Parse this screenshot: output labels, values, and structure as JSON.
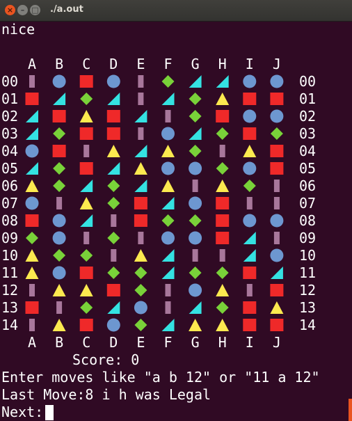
{
  "window": {
    "title": "./a.out",
    "close_icon": "close-icon",
    "minimize_icon": "minimize-icon",
    "maximize_icon": "maximize-icon"
  },
  "terminal": {
    "greeting": "nice",
    "score_line": "Score: 0",
    "instructions": "Enter moves like \"a b 12\" or \"11 a 12\"",
    "last_move": "Last Move:8 i h was Legal",
    "prompt": "Next:"
  },
  "board": {
    "columns": [
      "A",
      "B",
      "C",
      "D",
      "E",
      "F",
      "G",
      "H",
      "I",
      "J"
    ],
    "rows": [
      "00",
      "01",
      "02",
      "03",
      "04",
      "05",
      "06",
      "07",
      "08",
      "09",
      "10",
      "11",
      "12",
      "13",
      "14"
    ],
    "piece_colors": {
      "bar": "#a8779b",
      "circle": "#6d97d0",
      "square": "#ef2929",
      "diamond": "#79d239",
      "triangle": "#fce94f",
      "wedge": "#34e2e2"
    },
    "cells": [
      [
        "bar",
        "circle",
        "square",
        "circle",
        "bar",
        "diamond",
        "wedge",
        "wedge",
        "circle",
        "circle"
      ],
      [
        "square",
        "wedge",
        "diamond",
        "wedge",
        "bar",
        "wedge",
        "diamond",
        "triangle",
        "square",
        "square"
      ],
      [
        "wedge",
        "square",
        "triangle",
        "square",
        "wedge",
        "bar",
        "diamond",
        "square",
        "circle",
        "circle"
      ],
      [
        "wedge",
        "diamond",
        "square",
        "square",
        "bar",
        "circle",
        "wedge",
        "diamond",
        "square",
        "diamond"
      ],
      [
        "circle",
        "square",
        "bar",
        "triangle",
        "wedge",
        "triangle",
        "diamond",
        "bar",
        "triangle",
        "square"
      ],
      [
        "wedge",
        "diamond",
        "square",
        "wedge",
        "triangle",
        "circle",
        "circle",
        "diamond",
        "circle",
        "square"
      ],
      [
        "triangle",
        "diamond",
        "wedge",
        "diamond",
        "wedge",
        "triangle",
        "bar",
        "triangle",
        "diamond",
        "bar"
      ],
      [
        "circle",
        "bar",
        "triangle",
        "diamond",
        "square",
        "wedge",
        "circle",
        "square",
        "bar",
        "bar"
      ],
      [
        "square",
        "circle",
        "wedge",
        "bar",
        "square",
        "diamond",
        "diamond",
        "square",
        "circle",
        "circle"
      ],
      [
        "diamond",
        "circle",
        "bar",
        "diamond",
        "bar",
        "circle",
        "circle",
        "square",
        "wedge",
        "bar"
      ],
      [
        "triangle",
        "diamond",
        "diamond",
        "bar",
        "triangle",
        "wedge",
        "bar",
        "bar",
        "wedge",
        "circle"
      ],
      [
        "triangle",
        "circle",
        "square",
        "diamond",
        "diamond",
        "wedge",
        "diamond",
        "diamond",
        "square",
        "wedge"
      ],
      [
        "bar",
        "triangle",
        "triangle",
        "square",
        "diamond",
        "bar",
        "circle",
        "triangle",
        "bar",
        "square"
      ],
      [
        "square",
        "bar",
        "diamond",
        "wedge",
        "circle",
        "bar",
        "wedge",
        "diamond",
        "square",
        "triangle"
      ],
      [
        "bar",
        "triangle",
        "square",
        "circle",
        "diamond",
        "wedge",
        "triangle",
        "triangle",
        "square",
        "square"
      ]
    ]
  }
}
